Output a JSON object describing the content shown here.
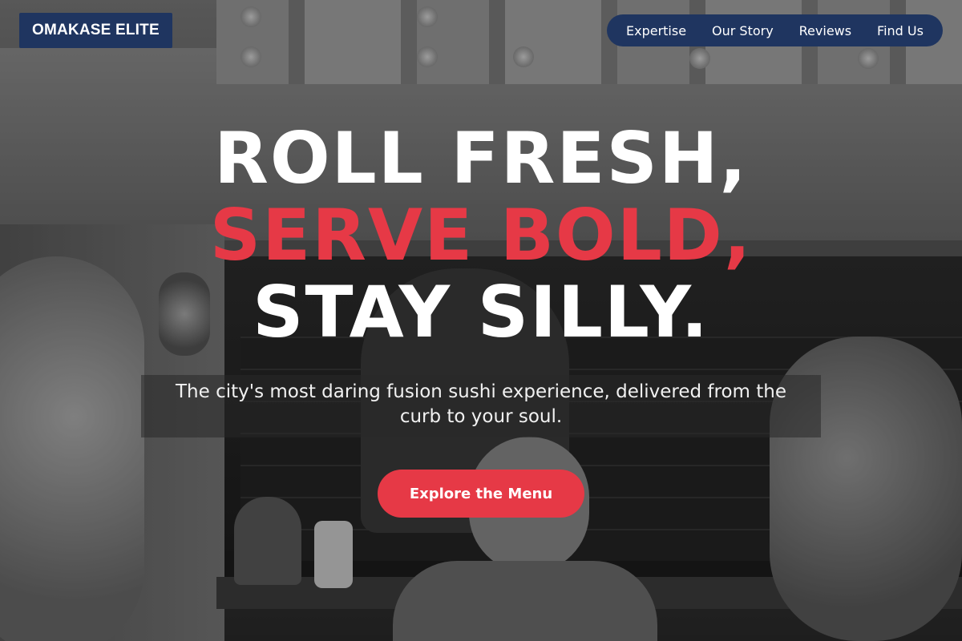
{
  "brand": {
    "logo_text": "OMAKASE ELITE",
    "navy": "#1f3560",
    "accent": "#e63946"
  },
  "nav": {
    "items": [
      {
        "label": "Expertise"
      },
      {
        "label": "Our Story"
      },
      {
        "label": "Reviews"
      },
      {
        "label": "Find Us"
      }
    ]
  },
  "hero": {
    "headline_line1": "ROLL FRESH,",
    "headline_line2": "SERVE BOLD,",
    "headline_line3": "STAY SILLY.",
    "subtitle": "The city's most daring fusion sushi experience, delivered from the curb to your soul.",
    "cta_label": "Explore the Menu",
    "background": "grayscale photo of a food truck service window with customers"
  }
}
